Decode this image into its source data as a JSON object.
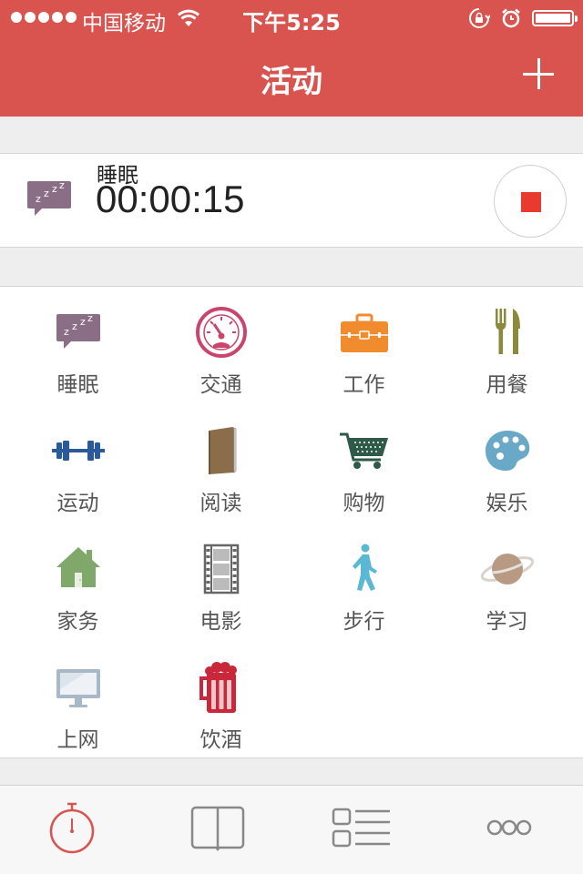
{
  "status_bar": {
    "carrier": "中国移动",
    "time": "下午5:25"
  },
  "nav": {
    "title": "活动"
  },
  "current_activity": {
    "name": "睡眠",
    "timer": "00:00:15",
    "icon": "sleep-icon"
  },
  "activities": [
    {
      "label": "睡眠",
      "icon": "sleep-icon",
      "color": "#8a6e85"
    },
    {
      "label": "交通",
      "icon": "speedometer-icon",
      "color": "#c9456b"
    },
    {
      "label": "工作",
      "icon": "briefcase-icon",
      "color": "#f08c2e"
    },
    {
      "label": "用餐",
      "icon": "fork-knife-icon",
      "color": "#8a8a3a"
    },
    {
      "label": "运动",
      "icon": "dumbbell-icon",
      "color": "#2a5a9a"
    },
    {
      "label": "阅读",
      "icon": "book-icon",
      "color": "#8b6d4a"
    },
    {
      "label": "购物",
      "icon": "cart-icon",
      "color": "#2f5a4a"
    },
    {
      "label": "娱乐",
      "icon": "palette-icon",
      "color": "#6aa8c8"
    },
    {
      "label": "家务",
      "icon": "house-icon",
      "color": "#7fa86a"
    },
    {
      "label": "电影",
      "icon": "film-icon",
      "color": "#777777"
    },
    {
      "label": "步行",
      "icon": "walking-icon",
      "color": "#5ab8d4"
    },
    {
      "label": "学习",
      "icon": "planet-icon",
      "color": "#b89a84"
    },
    {
      "label": "上网",
      "icon": "monitor-icon",
      "color": "#a8b8c8"
    },
    {
      "label": "饮酒",
      "icon": "beer-icon",
      "color": "#c8283a"
    }
  ],
  "tabs": [
    {
      "icon": "stopwatch-icon",
      "active": true
    },
    {
      "icon": "book-open-icon",
      "active": false
    },
    {
      "icon": "list-icon",
      "active": false
    },
    {
      "icon": "more-icon",
      "active": false
    }
  ],
  "colors": {
    "header": "#d9534f",
    "stop": "#e83a2f"
  }
}
